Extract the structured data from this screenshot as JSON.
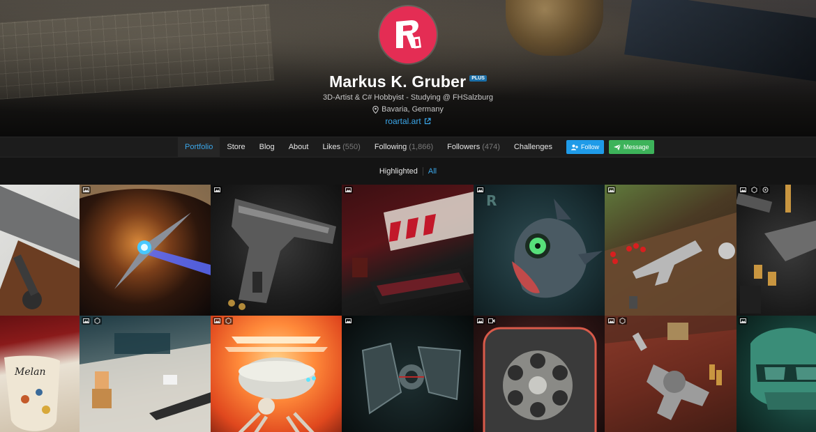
{
  "profile": {
    "avatar_letters": "R",
    "name": "Markus K. Gruber",
    "badge": "PLUS",
    "tagline": "3D-Artist & C# Hobbyist - Studying @ FHSalzburg",
    "location": "Bavaria, Germany",
    "website": "roartal.art"
  },
  "nav": {
    "tabs": [
      {
        "label": "Portfolio",
        "count": ""
      },
      {
        "label": "Store",
        "count": ""
      },
      {
        "label": "Blog",
        "count": ""
      },
      {
        "label": "About",
        "count": ""
      },
      {
        "label": "Likes",
        "count": "(550)"
      },
      {
        "label": "Following",
        "count": "(1,866)"
      },
      {
        "label": "Followers",
        "count": "(474)"
      },
      {
        "label": "Challenges",
        "count": ""
      }
    ],
    "follow_label": "Follow",
    "message_label": "Message"
  },
  "filter": {
    "highlighted_label": "Highlighted",
    "all_label": "All"
  },
  "colors": {
    "accent": "#3ba7ea",
    "follow": "#1f9be8",
    "message": "#3db35a",
    "avatar": "#e42d54"
  },
  "grid": {
    "tiles": [
      {
        "name": "rifle-bolt",
        "icons": []
      },
      {
        "name": "spaceship",
        "icons": [
          "image-icon"
        ]
      },
      {
        "name": "pistol",
        "icons": [
          "image-icon"
        ]
      },
      {
        "name": "gaming-desk",
        "icons": [
          "image-icon"
        ]
      },
      {
        "name": "fish-creature",
        "icons": [
          "image-icon"
        ]
      },
      {
        "name": "pistol-on-wood",
        "icons": [
          "image-icon"
        ]
      },
      {
        "name": "ammo-and-gun",
        "icons": [
          "image-icon",
          "3d-icon",
          "target-icon"
        ]
      },
      {
        "name": "decorated-cup",
        "icons": []
      },
      {
        "name": "lego-figure",
        "icons": [
          "image-icon",
          "3d-icon"
        ]
      },
      {
        "name": "hover-robot",
        "icons": [
          "image-icon",
          "3d-icon"
        ]
      },
      {
        "name": "tie-fighter",
        "icons": [
          "image-icon"
        ]
      },
      {
        "name": "revolver-cylinder-phone",
        "icons": [
          "image-icon",
          "video-icon"
        ]
      },
      {
        "name": "revolver-on-table",
        "icons": [
          "image-icon",
          "3d-icon"
        ]
      },
      {
        "name": "green-mask",
        "icons": [
          "image-icon"
        ]
      }
    ]
  }
}
